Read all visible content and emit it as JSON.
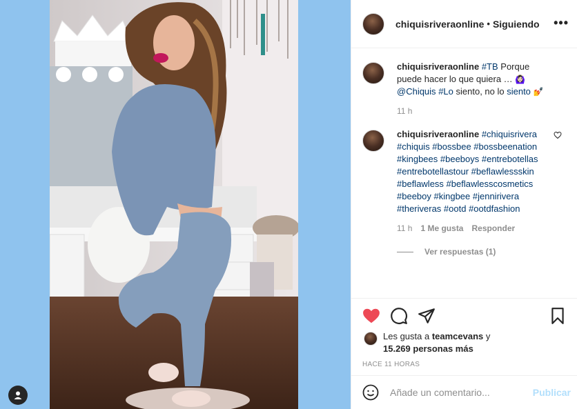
{
  "header": {
    "username": "chiquisriveraonline",
    "separator": "•",
    "following_label": "Siguiendo",
    "more_label": "•••"
  },
  "caption": {
    "username": "chiquisriveraonline",
    "hashtag_tb": "#TB",
    "text_1": " Porque puede hacer lo que quiera … ",
    "emoji_1": "🙆🏻‍♀️",
    "mention": "@Chiquis",
    "hashtag_2": "#Lo",
    "text_2": " siento, no lo ",
    "hashtag_3": "siento",
    "emoji_2": "💅",
    "time": "11 h"
  },
  "comment": {
    "username": "chiquisriveraonline",
    "hashtags": "#chiquisrivera #chiquis #bossbee #bossbeenation #kingbees #beeboys #entrebotellas #entrebotellastour #beflawlessskin #beflawless #beflawlesscosmetics #beeboy #kingbee #jennirivera #theriveras #ootd #ootdfashion",
    "time": "11 h",
    "likes": "1 Me gusta",
    "reply": "Responder",
    "view_replies": "Ver respuestas (1)"
  },
  "likes": {
    "prefix": "Les gusta a ",
    "user": "teamcevans",
    "suffix": " y ",
    "count": "15.269 personas más"
  },
  "timestamp": "HACE 11 HORAS",
  "add_comment": {
    "placeholder": "Añade un comentario...",
    "post_label": "Publicar"
  },
  "colors": {
    "background": "#8fc3ee",
    "like_red": "#ed4956",
    "link_blue": "#00376b",
    "muted": "#8e8e8e",
    "post_disabled": "#b2dffc"
  }
}
